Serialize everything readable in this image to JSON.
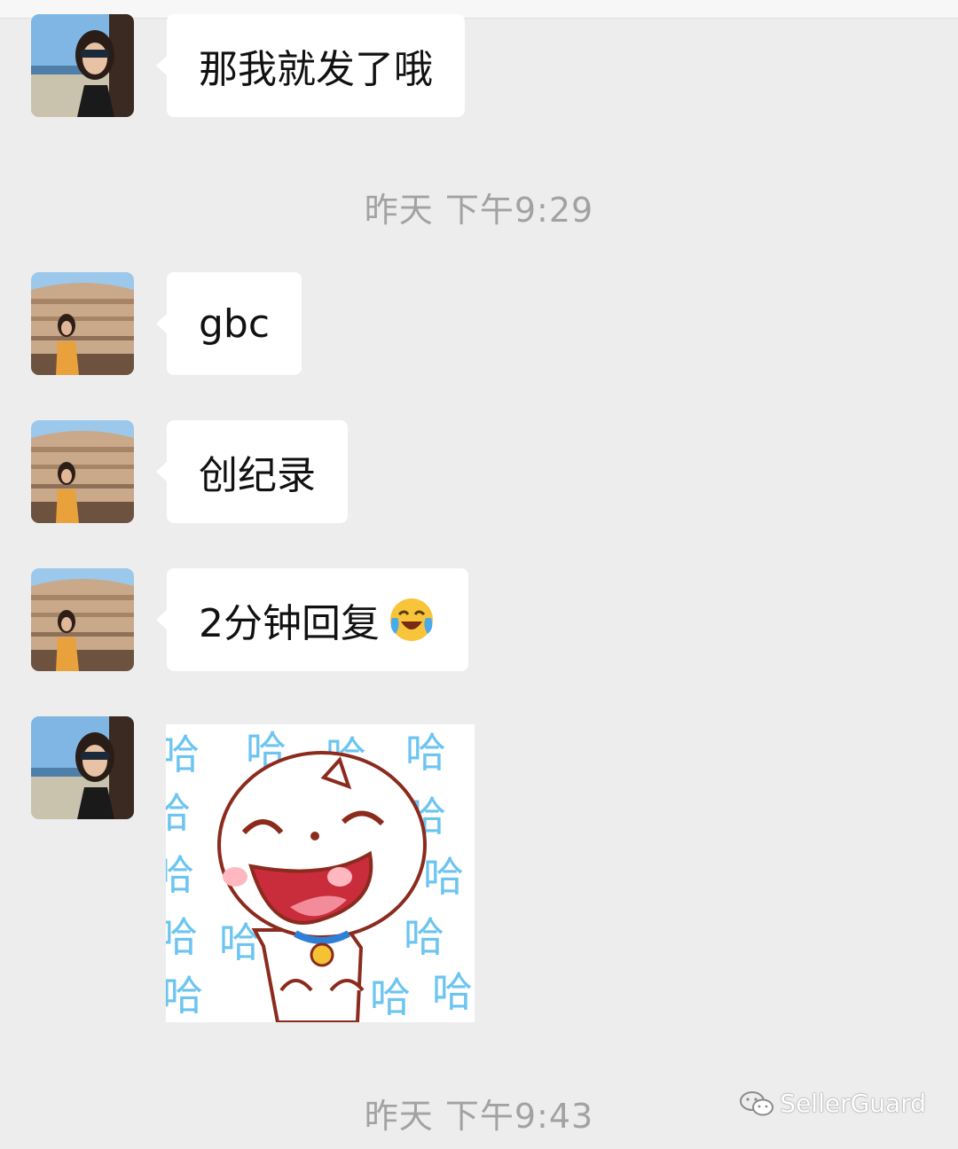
{
  "messages": [
    {
      "text": "那我就发了哦",
      "avatar": "sunglasses-avatar"
    },
    {
      "text": "gbc",
      "avatar": "colosseum-avatar"
    },
    {
      "text": "创纪录",
      "avatar": "colosseum-avatar"
    },
    {
      "text": "2分钟回复",
      "emoji": "laughing-crying-emoji",
      "avatar": "colosseum-avatar"
    },
    {
      "sticker": "laughing-cat-sticker",
      "sticker_text": "哈",
      "avatar": "sunglasses-avatar"
    }
  ],
  "timestamps": [
    "昨天 下午9:29",
    "昨天 下午9:43"
  ],
  "watermark": {
    "text": "SellerGuard",
    "icon": "wechat-icon"
  },
  "colors": {
    "background": "#ededed",
    "bubble": "#ffffff",
    "timestamp": "#a2a2a2",
    "sticker_text": "#6cc5f0"
  }
}
